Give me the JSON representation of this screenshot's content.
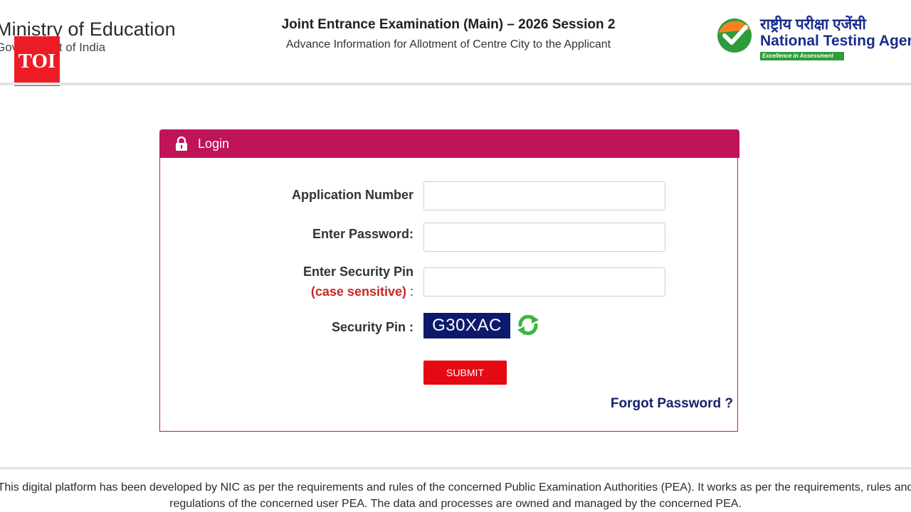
{
  "header": {
    "ministry_title": "Ministry of Education",
    "ministry_sub": "Government of India",
    "toi_badge": "TOI",
    "exam_title": "Joint Entrance Examination (Main) – 2026 Session 2",
    "exam_subtitle": "Advance Information for Allotment of Centre City to the Applicant",
    "nta_hindi": "राष्ट्रीय परीक्षा एजेंसी",
    "nta_english": "National Testing Agency",
    "nta_tagline": "Excellence in Assessment"
  },
  "login": {
    "panel_title": "Login",
    "application_number_label": "Application Number",
    "application_number_value": "",
    "password_label": "Enter Password:",
    "password_value": "",
    "security_pin_label": "Enter Security Pin",
    "case_sensitive_note": "(case sensitive)",
    "case_sensitive_colon": ":",
    "security_pin_value": "",
    "captcha_label": "Security Pin :",
    "captcha_code": "G30XAC",
    "submit_label": "SUBMIT",
    "forgot_password_label": "Forgot Password ?"
  },
  "footer": {
    "line1": "This digital platform has been developed by NIC as per the requirements and rules of the concerned Public Examination Authorities (PEA). It works as per the requirements, rules and",
    "line2": "regulations of the concerned user PEA. The data and processes are owned and managed by the concerned PEA."
  },
  "colors": {
    "panel_header": "#c0145a",
    "captcha_bg": "#0d1a6b",
    "submit_bg": "#e50914",
    "forgot_link": "#14226e",
    "toi_red": "#ed1c24",
    "nta_blue": "#1a2c8c"
  },
  "icons": {
    "lock": "lock-icon",
    "refresh": "refresh-icon",
    "nta_logo": "nta-checkmark-logo"
  }
}
